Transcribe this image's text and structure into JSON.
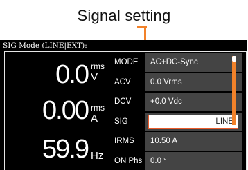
{
  "callout": {
    "label": "Signal setting"
  },
  "mode_bar": {
    "title": "SIG Mode (LINE|EXT):"
  },
  "measurements": [
    {
      "value": "0.0",
      "unit_top": "rms",
      "unit_bottom": "V"
    },
    {
      "value": "0.00",
      "unit_top": "rms",
      "unit_bottom": "A"
    },
    {
      "value": "59.9",
      "unit_top": "",
      "unit_bottom": "Hz"
    }
  ],
  "parameters": [
    {
      "name": "MODE",
      "value": "AC+DC-Sync"
    },
    {
      "name": "ACV",
      "value": "0.0 Vrms"
    },
    {
      "name": "DCV",
      "value": "+0.0 Vdc"
    },
    {
      "name": "SIG",
      "value": "LINE",
      "selected": true
    },
    {
      "name": "IRMS",
      "value": "10.50 A"
    },
    {
      "name": "ON Phs",
      "value": "0.0 °"
    }
  ],
  "colors": {
    "accent": "#f2822a",
    "selection_border": "#e95a2a",
    "screen_bg": "#000000",
    "param_value_bg": "#444444"
  }
}
